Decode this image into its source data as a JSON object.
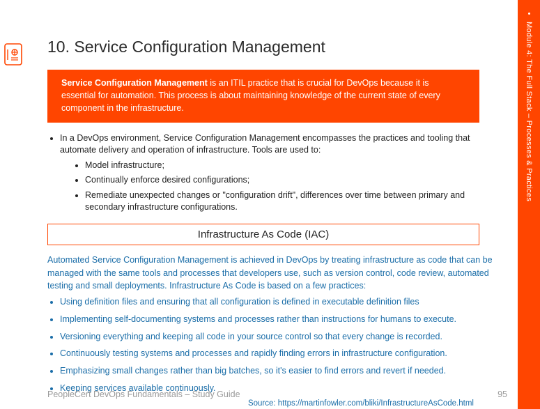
{
  "sidebar": {
    "label": "Module 4: The Full Stack – Processes & Practices"
  },
  "heading": "10. Service Configuration Management",
  "callout": {
    "bold": "Service Configuration Management",
    "rest": " is an ITIL  practice that is crucial for DevOps because it is essential for automation. This process is about maintaining knowledge of the current state of every component in the infrastructure."
  },
  "intro_bullet": "In a DevOps environment,  Service Configuration Management encompasses the practices and tooling that automate delivery and operation of infrastructure.  Tools are used to:",
  "sub_bullets": [
    "Model infrastructure;",
    "Continually  enforce desired configurations;",
    "Remediate unexpected  changes or \"configuration drift\", differences over time between primary and secondary infrastructure  configurations."
  ],
  "iac_title": "Infrastructure As Code (IAC)",
  "blue_intro": "Automated Service Configuration Management is achieved in DevOps by treating infrastructure  as code that can be managed with the same tools and processes that developers use, such as version control, code review, automated testing and small deployments.  Infrastructure  As Code is based on a few practices:",
  "blue_bullets": [
    "Using definition files and ensuring  that all configuration is defined in executable  definition files",
    "Implementing  self-documenting systems and processes rather than instructions for humans to execute.",
    "Versioning everything  and keeping all code in your source control so that every change is recorded.",
    "Continuously  testing systems and processes and rapidly finding errors in infrastructure  configuration.",
    "Emphasizing small changes rather than big batches, so it's easier to find errors and revert if needed.",
    "Keeping services available continuously."
  ],
  "source": "Source: https://martinfowler.com/bliki/InfrastructureAsCode.html",
  "footer_left": "PeopleCert DevOps Fundamentals  – Study Guide",
  "footer_page": "95"
}
